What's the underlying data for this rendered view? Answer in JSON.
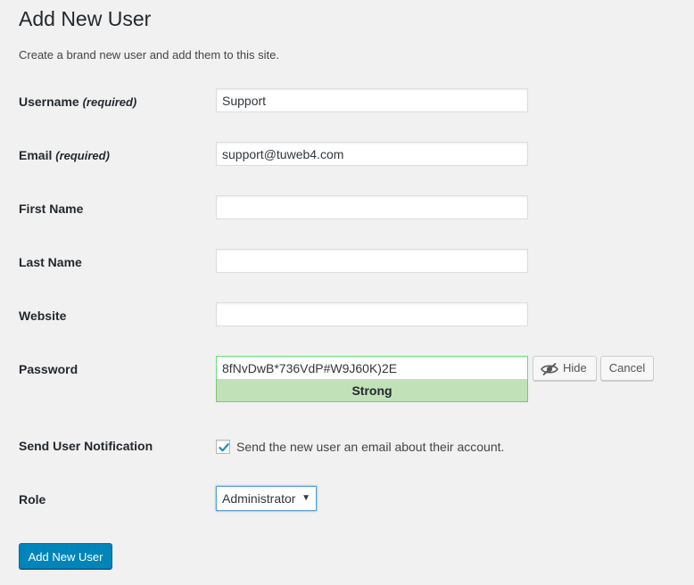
{
  "page": {
    "title": "Add New User",
    "subtitle": "Create a brand new user and add them to this site."
  },
  "form": {
    "username": {
      "label": "Username",
      "required_note": "(required)",
      "value": "Support"
    },
    "email": {
      "label": "Email",
      "required_note": "(required)",
      "value": "support@tuweb4.com"
    },
    "first_name": {
      "label": "First Name",
      "value": ""
    },
    "last_name": {
      "label": "Last Name",
      "value": ""
    },
    "website": {
      "label": "Website",
      "value": ""
    },
    "password": {
      "label": "Password",
      "value": "8fNvDwB*736VdP#W9J60K)2E",
      "strength": "Strong",
      "hide_label": "Hide",
      "cancel_label": "Cancel",
      "hide_icon": "eye-slash-icon"
    },
    "notification": {
      "label": "Send User Notification",
      "checkbox_label": "Send the new user an email about their account.",
      "checked": true
    },
    "role": {
      "label": "Role",
      "selected": "Administrator"
    },
    "submit_label": "Add New User"
  },
  "colors": {
    "primary": "#0085ba",
    "strong_bg": "#c1e1b9",
    "strong_border": "#83c373"
  }
}
